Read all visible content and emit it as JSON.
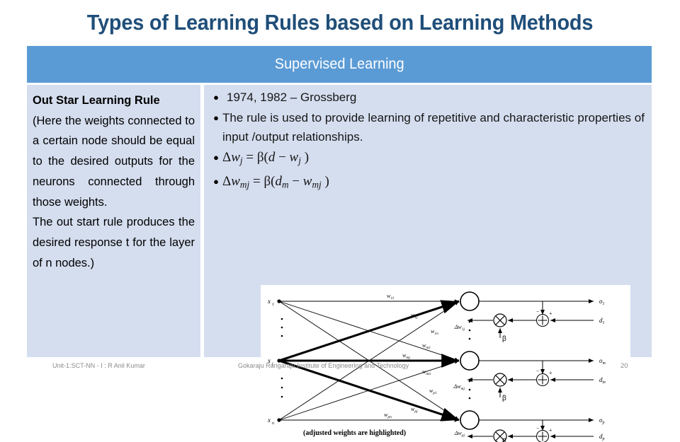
{
  "slide": {
    "title": "Types of Learning Rules based on Learning Methods",
    "title_color": "#1F4E79",
    "section_bar": {
      "label": "Supervised Learning",
      "color": "#5B9BD5",
      "text_color": "#FFFFFF"
    },
    "panel_color": "#D5DEEF"
  },
  "left_panel": {
    "heading": "Out Star Learning Rule",
    "paragraph_1": "(Here the weights connected to a certain node should be equal to the desired outputs for the neurons connected through those weights.",
    "paragraph_2": "The out start rule produces the desired response t for the layer of n nodes.)"
  },
  "right_panel": {
    "bullets": [
      {
        "type": "text",
        "text": "1974, 1982 – Grossberg"
      },
      {
        "type": "text",
        "text": "The rule is used to provide learning of repetitive and characteristic properties of input /output relationships."
      },
      {
        "type": "math",
        "text": "Δwj = β( d − wj )"
      },
      {
        "type": "math",
        "text": "Δwmj = β( dm − wmj )"
      }
    ],
    "formula_1": {
      "lhs_symbol": "Δw",
      "lhs_sub": "j",
      "coeff": "β",
      "rhs": "d − w",
      "rhs_sub": "j"
    },
    "formula_2": {
      "lhs_symbol": "Δw",
      "lhs_sub": "mj",
      "coeff": "β",
      "rhs": "d",
      "rhs_sub": "m",
      "rhs2": "w",
      "rhs2_sub": "mj"
    }
  },
  "diagram": {
    "caption": "(adjusted weights are highlighted)",
    "input_labels": [
      "x1",
      "xj",
      "xn"
    ],
    "output_labels": [
      "o1",
      "om",
      "op"
    ],
    "desired_labels": [
      "d1",
      "dm",
      "dp"
    ],
    "delta_labels": [
      "Δw1j",
      "Δwmj",
      "Δwpj"
    ],
    "beta_label": "β",
    "weight_labels": [
      "w11",
      "w1j",
      "w1n",
      "wm1",
      "wmj",
      "wmn",
      "wp1",
      "wpj",
      "wpn"
    ],
    "sum_sign_minus": "−",
    "sum_sign_plus": "+"
  },
  "footer": {
    "left": "Unit-1:SCT-NN - I : R  Anil Kumar",
    "center": "Gokaraju Rangaraju Institute of Engineering and Technology",
    "page": "20"
  }
}
